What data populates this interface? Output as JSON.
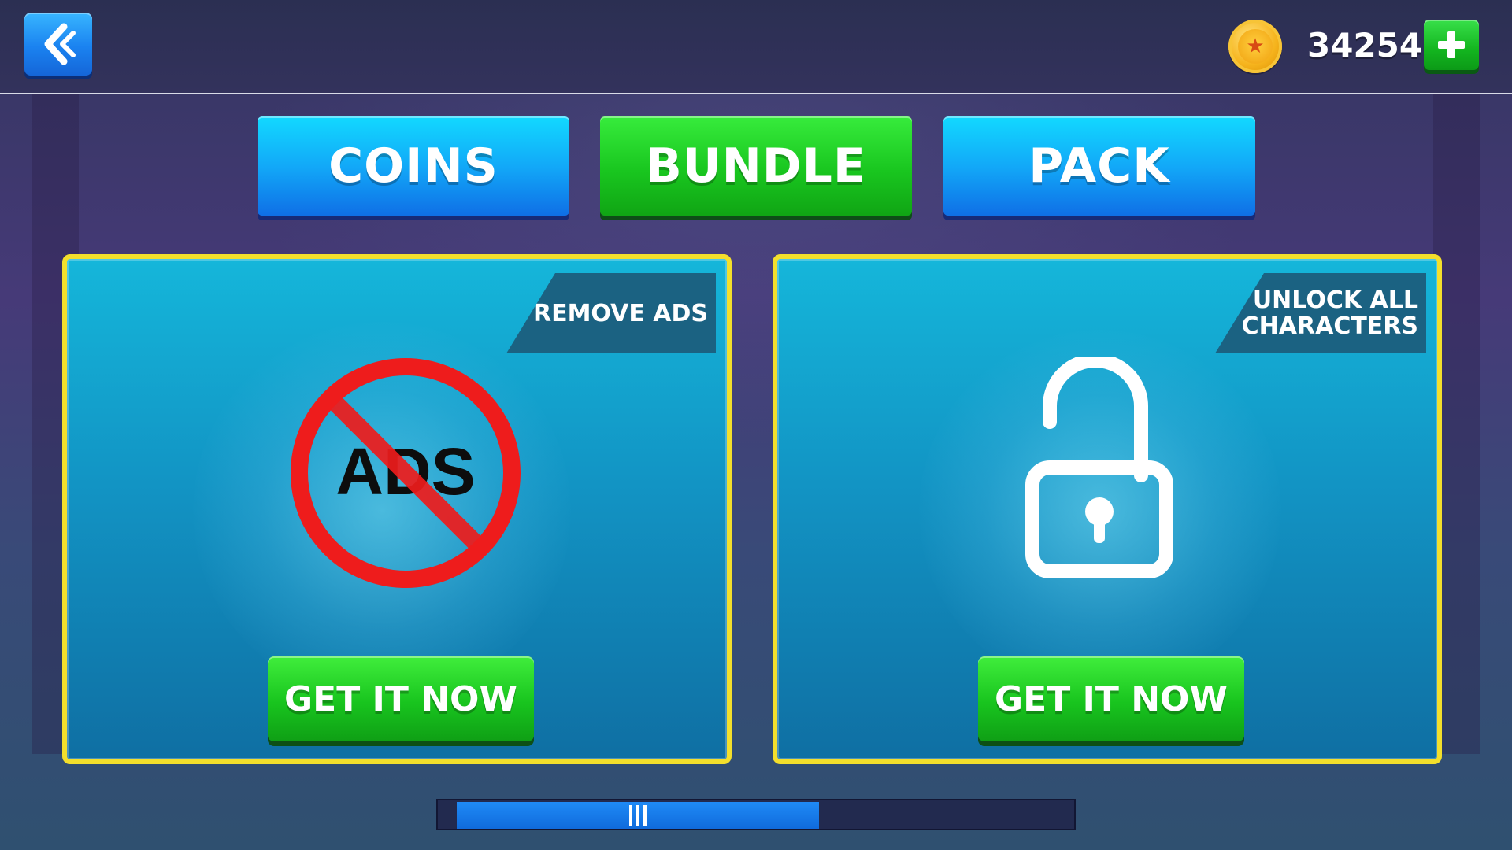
{
  "header": {
    "back_icon": "chevron-double-left-icon",
    "coin_icon": "gold-star-coin-icon",
    "coin_count": "34254",
    "add_icon": "plus-icon"
  },
  "tabs": [
    {
      "label": "COINS",
      "selected": false
    },
    {
      "label": "BUNDLE",
      "selected": true
    },
    {
      "label": "PACK",
      "selected": false
    }
  ],
  "cards": [
    {
      "ribbon": "REMOVE ADS",
      "icon": "no-ads-icon",
      "icon_text": "ADS",
      "button_label": "GET IT NOW"
    },
    {
      "ribbon_line1": "UNLOCK ALL",
      "ribbon_line2": "CHARACTERS",
      "icon": "unlocked-padlock-icon",
      "button_label": "GET IT NOW"
    }
  ],
  "scrollbar": {
    "position_fraction": 0.0,
    "visible_fraction": 0.57
  },
  "colors": {
    "tab_blue": "#12a9f8",
    "tab_green": "#19c61f",
    "card_border": "#f3df2c",
    "card_bg": "#1294c4",
    "no_ads_red": "#ee1c1c"
  }
}
